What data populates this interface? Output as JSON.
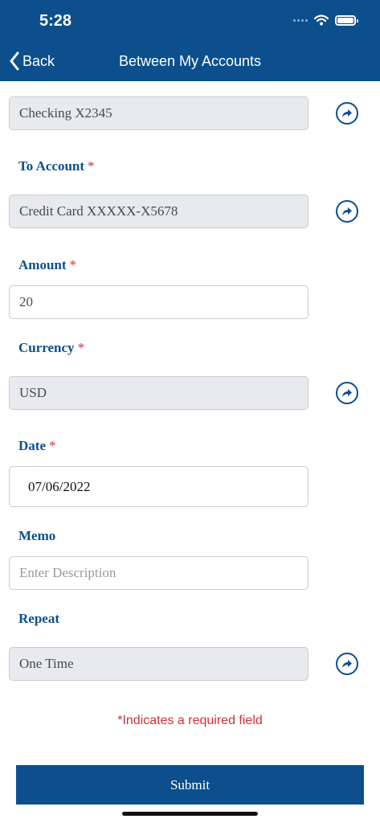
{
  "status_bar": {
    "time": "5:28"
  },
  "header": {
    "back_label": "Back",
    "title": "Between My Accounts"
  },
  "form": {
    "from_account": {
      "value": "Checking X2345"
    },
    "to_account": {
      "label": "To Account",
      "value": "Credit Card XXXXX-X5678"
    },
    "amount": {
      "label": "Amount",
      "value": "20"
    },
    "currency": {
      "label": "Currency",
      "value": "USD"
    },
    "date": {
      "label": "Date",
      "value": "07/06/2022"
    },
    "memo": {
      "label": "Memo",
      "placeholder": "Enter Description"
    },
    "repeat": {
      "label": "Repeat",
      "value": "One Time"
    },
    "required_mark": "*"
  },
  "required_note": "*Indicates a required field",
  "submit_label": "Submit"
}
